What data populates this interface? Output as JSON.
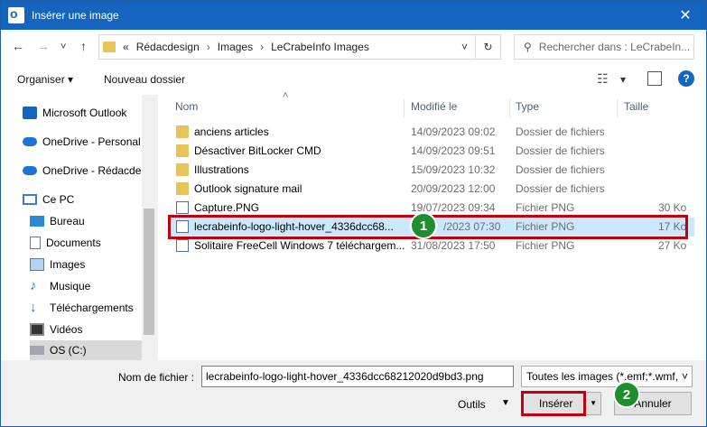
{
  "window": {
    "title": "Insérer une image",
    "close_glyph": "✕"
  },
  "nav": {
    "back_glyph": "←",
    "forward_glyph": "→",
    "recent_glyph": "˅",
    "up_glyph": "↑",
    "breadcrumb": {
      "overflow": "«",
      "items": [
        "Rédacdesign",
        "Images",
        "LeCrabeInfo Images"
      ],
      "sep": "›"
    },
    "refresh_glyph": "↻",
    "dropdown_glyph": "˅",
    "search_placeholder": "Rechercher dans : LeCrabeIn..."
  },
  "toolbar": {
    "organise": "Organiser",
    "organise_caret": "▾",
    "new_folder": "Nouveau dossier",
    "view_glyph": "☷",
    "view_caret": "▾",
    "help": "?"
  },
  "sidebar": {
    "items": [
      {
        "label": "Microsoft Outlook",
        "icon": "outlook-icon"
      },
      {
        "label": "OneDrive - Personal",
        "icon": "cloud-icon"
      },
      {
        "label": "OneDrive - Rédacdes",
        "icon": "cloud-icon"
      },
      {
        "label": "Ce PC",
        "icon": "pc-icon"
      },
      {
        "label": "Bureau",
        "icon": "desktop-icon"
      },
      {
        "label": "Documents",
        "icon": "documents-icon"
      },
      {
        "label": "Images",
        "icon": "pictures-icon"
      },
      {
        "label": "Musique",
        "icon": "music-icon"
      },
      {
        "label": "Téléchargements",
        "icon": "download-icon"
      },
      {
        "label": "Vidéos",
        "icon": "video-icon"
      },
      {
        "label": "OS (C:)",
        "icon": "drive-icon"
      }
    ]
  },
  "columns": {
    "name": "Nom",
    "modified": "Modifié le",
    "type": "Type",
    "size": "Taille",
    "sort_glyph": "˄"
  },
  "files": [
    {
      "name": "anciens articles",
      "modified": "14/09/2023 09:02",
      "type": "Dossier de fichiers",
      "size": "",
      "kind": "folder"
    },
    {
      "name": "Désactiver BitLocker CMD",
      "modified": "14/09/2023 09:51",
      "type": "Dossier de fichiers",
      "size": "",
      "kind": "folder"
    },
    {
      "name": "Illustrations",
      "modified": "15/09/2023 10:32",
      "type": "Dossier de fichiers",
      "size": "",
      "kind": "folder"
    },
    {
      "name": "Outlook signature mail",
      "modified": "20/09/2023 12:00",
      "type": "Dossier de fichiers",
      "size": "",
      "kind": "folder"
    },
    {
      "name": "Capture.PNG",
      "modified": "19/07/2023 09:34",
      "type": "Fichier PNG",
      "size": "30 Ko",
      "kind": "png"
    },
    {
      "name": "lecrabeinfo-logo-light-hover_4336dcc68...",
      "modified": "/2023 07:30",
      "type": "Fichier PNG",
      "size": "17 Ko",
      "kind": "png"
    },
    {
      "name": "Solitaire FreeCell Windows 7 téléchargem...",
      "modified": "31/08/2023 17:50",
      "type": "Fichier PNG",
      "size": "27 Ko",
      "kind": "png"
    }
  ],
  "badges": {
    "one": "1",
    "two": "2"
  },
  "footer": {
    "filename_label": "Nom de fichier :",
    "filename_value": "lecrabeinfo-logo-light-hover_4336dcc68212020d9bd3.png",
    "filetype": "Toutes les images (*.emf;*.wmf,",
    "filetype_caret": "˅",
    "tools": "Outils",
    "tools_caret": "▼",
    "insert": "Insérer",
    "insert_caret": "▼",
    "cancel": "Annuler"
  },
  "colors": {
    "titlebar": "#1565c0",
    "selection": "#cce8ff",
    "highlight": "#c0000b",
    "badge": "#1e8e2e"
  }
}
